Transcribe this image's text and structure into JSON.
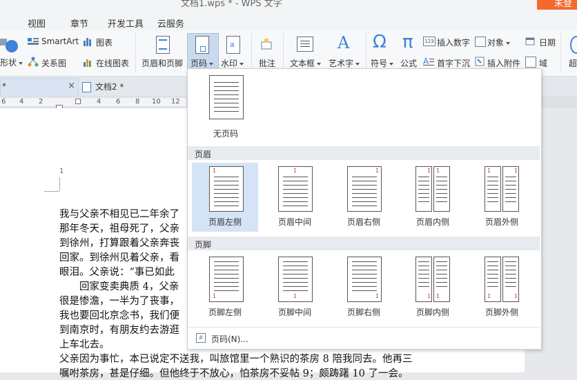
{
  "window": {
    "title": "文档1.wps * - WPS 文字",
    "login_label": "未登"
  },
  "menu": [
    "视图",
    "章节",
    "开发工具",
    "云服务"
  ],
  "ribbon": {
    "smartart": "SmartArt",
    "chart": "图表",
    "relation": "关系图",
    "online_chart": "在线图表",
    "shape": "形状",
    "header_footer": "页眉和页脚",
    "page_number": "页码",
    "watermark": "水印",
    "comment": "批注",
    "textbox": "文本框",
    "wordart": "艺术字",
    "symbol": "符号",
    "formula": "公式",
    "insert_number": "插入数字",
    "object": "对象",
    "date": "日期",
    "dropcap": "首字下沉",
    "attachment": "插入附件",
    "field": "域",
    "overflow": "超"
  },
  "tabs": {
    "doc1_label": "*",
    "doc2_label": "文档2 *"
  },
  "ruler_numbers": [
    "6",
    "4",
    "2",
    "2",
    "4",
    "6",
    "8",
    "10",
    "12"
  ],
  "page": {
    "page_number": "1",
    "lines": [
      "我与父亲不相见已二年余了",
      "那年冬天，祖母死了，父亲",
      "到徐州，打算跟着父亲奔丧",
      "回家。到徐州见着父亲，看",
      "眼泪。父亲说：“事已如此",
      "　　回家变卖典质 4，父亲",
      "很是惨澹，一半为了丧事，",
      "我也要回北京念书，我们便",
      "到南京时，有朋友约去游逛",
      "上车北去。",
      "父亲因为事忙，本已说定不送我，叫旅馆里一个熟识的茶房 8 陪我同去。他再三",
      "嘱咐茶房，甚是仔细。但他终于不放心，怕茶房不妥帖 9；颇踌躇 10 了一会。"
    ]
  },
  "dropdown": {
    "no_page_number": "无页码",
    "header_section": "页眉",
    "footer_section": "页脚",
    "header_options": [
      "页眉左侧",
      "页眉中间",
      "页眉右侧",
      "页眉内侧",
      "页眉外侧"
    ],
    "footer_options": [
      "页脚左侧",
      "页脚中间",
      "页脚右侧",
      "页脚内侧",
      "页脚外侧"
    ],
    "selected": "页眉左侧",
    "more_label": "页码(N)...",
    "thumb_page_number": "1"
  }
}
